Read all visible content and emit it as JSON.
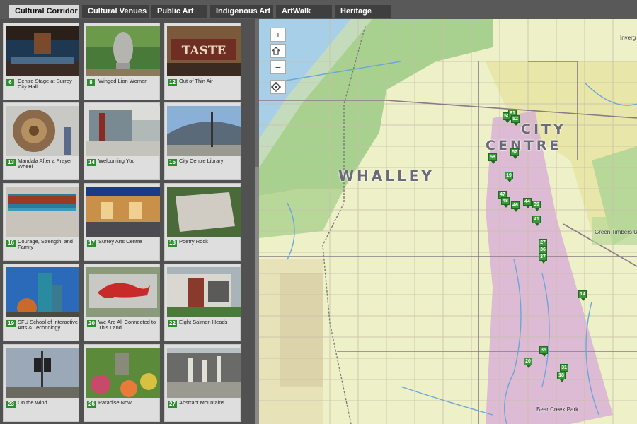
{
  "tabs": [
    {
      "label": "Cultural Corridor",
      "active": true
    },
    {
      "label": "Cultural Venues",
      "active": false
    },
    {
      "label": "Public Art",
      "active": false
    },
    {
      "label": "Indigenous Art",
      "active": false
    },
    {
      "label": "ArtWalk",
      "active": false
    },
    {
      "label": "Heritage",
      "active": false
    }
  ],
  "gallery": [
    {
      "num": "6",
      "title": "Centre Stage at Surrey City Hall"
    },
    {
      "num": "8",
      "title": "Winged Lion Woman"
    },
    {
      "num": "12",
      "title": "Out of Thin Air",
      "thumb_text": "TASTE"
    },
    {
      "num": "13",
      "title": "Mandala After a Prayer Wheel"
    },
    {
      "num": "14",
      "title": "Welcoming You"
    },
    {
      "num": "15",
      "title": "City Centre Library"
    },
    {
      "num": "16",
      "title": "Courage, Strength, and Family"
    },
    {
      "num": "17",
      "title": "Surrey Arts Centre"
    },
    {
      "num": "18",
      "title": "Poetry Rock"
    },
    {
      "num": "19",
      "title": "SFU School of Interactive Arts & Technology"
    },
    {
      "num": "20",
      "title": "We Are All Connected to This Land"
    },
    {
      "num": "22",
      "title": "Eight Salmon Heads"
    },
    {
      "num": "23",
      "title": "On the Wind"
    },
    {
      "num": "26",
      "title": "Paradise Now"
    },
    {
      "num": "27",
      "title": "Abstract Mountains"
    }
  ],
  "map": {
    "controls": {
      "zoom_in": "+",
      "zoom_out": "−"
    },
    "labels": {
      "whalley": "WHALLEY",
      "city": "CITY",
      "centre": "CENTRE",
      "green_timbers": "Green Timbers U",
      "bear_creek": "Bear Creek Park",
      "inverg": "Inverg"
    },
    "markers": [
      "54",
      "61",
      "52",
      "57",
      "58",
      "19",
      "47",
      "48",
      "44",
      "46",
      "39",
      "41",
      "27",
      "36",
      "37",
      "14",
      "35",
      "20",
      "31",
      "18"
    ]
  },
  "colors": {
    "tab_active": "#d9d9d9",
    "marker_green": "#3a9a3a",
    "corridor_pink": "#d7a9d9",
    "park_green": "#9ccc8e",
    "water_blue": "#6aa7d8"
  }
}
